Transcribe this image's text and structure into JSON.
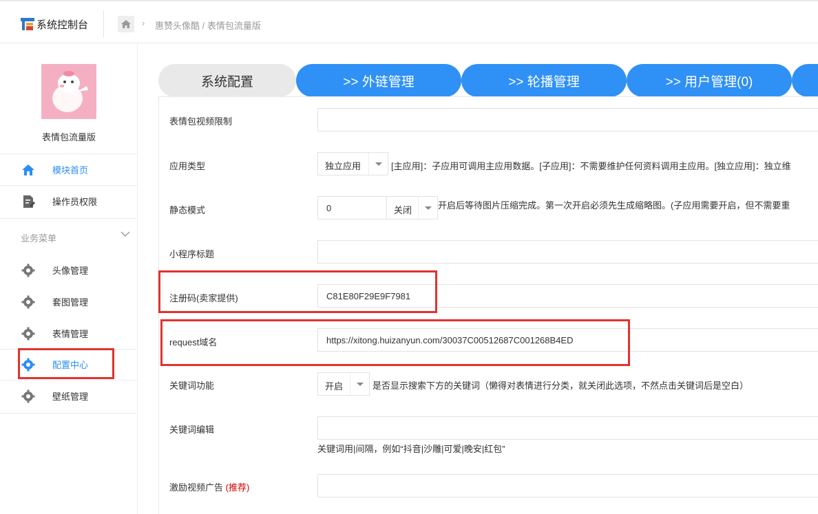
{
  "topbar": {
    "title": "系统控制台",
    "breadcrumb": "惠赞头像酷 / 表情包流量版"
  },
  "sidebar": {
    "app_name": "表情包流量版",
    "items": [
      {
        "label": "模块首页"
      },
      {
        "label": "操作员权限"
      }
    ],
    "section_title": "业务菜单",
    "business_items": [
      {
        "label": "头像管理"
      },
      {
        "label": "套图管理"
      },
      {
        "label": "表情管理"
      },
      {
        "label": "配置中心"
      },
      {
        "label": "壁纸管理"
      }
    ]
  },
  "tabs": [
    {
      "label": "系统配置"
    },
    {
      "label": ">> 外链管理"
    },
    {
      "label": ">> 轮播管理"
    },
    {
      "label": ">> 用户管理(0)"
    }
  ],
  "form": {
    "video_limit_label": "表情包视频限制",
    "app_type_label": "应用类型",
    "app_type_value": "独立应用",
    "app_type_hint": "[主应用]：子应用可调用主应用数据。[子应用]：不需要维护任何资料调用主应用。[独立应用]：独立维",
    "static_mode_label": "静态模式",
    "static_mode_value": "0",
    "static_mode_select": "关闭",
    "static_mode_hint": "开启后等待图片压缩完成。第一次开启必须先生成缩略图。(子应用需要开启，但不需要重",
    "mini_title_label": "小程序标题",
    "reg_code_label": "注册码(卖家提供)",
    "reg_code_value": "C81E80F29E9F7981",
    "request_domain_label": "request域名",
    "request_domain_value": "https://xitong.huizanyun.com/30037C00512687C001268B4ED",
    "keyword_func_label": "关键词功能",
    "keyword_func_value": "开启",
    "keyword_func_hint": "是否显示搜索下方的关键词（懒得对表情进行分类，就关闭此选项，不然点击关键词后是空白）",
    "keyword_edit_label": "关键词编辑",
    "keyword_edit_hint": "关键词用|间隔，例如“抖音|沙雕|可爱|晚安|红包”",
    "reward_ad_label": "激励视频广告",
    "reward_ad_tag": "(推荐)"
  },
  "colors": {
    "accent": "#2f90f6",
    "highlight": "#e2322e"
  }
}
